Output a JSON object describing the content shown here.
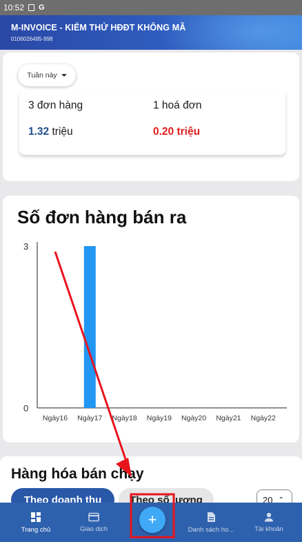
{
  "status_bar": {
    "time": "10:52",
    "icon_g": "G"
  },
  "header": {
    "title": "M-INVOICE - KIỂM THỬ HĐĐT KHÔNG MÃ",
    "tax_code": "0106026495-998"
  },
  "summary": {
    "period_label": "Tuần này",
    "orders_count": "3 đơn hàng",
    "invoices_count": "1 hoá đơn",
    "orders_revenue_value": "1.32",
    "orders_revenue_unit": " triệu",
    "invoices_revenue": "0.20 triệu"
  },
  "chart_data": {
    "type": "bar",
    "title": "Số đơn hàng bán ra",
    "categories": [
      "Ngày16",
      "Ngày17",
      "Ngày18",
      "Ngày19",
      "Ngày20",
      "Ngày21",
      "Ngày22"
    ],
    "values": [
      0,
      3,
      0,
      0,
      0,
      0,
      0
    ],
    "ylim": [
      0,
      3
    ],
    "y_ticks": [
      "0",
      "3"
    ],
    "bar_color": "#2196f3",
    "grid": false
  },
  "best_sellers": {
    "title": "Hàng hóa bán chạy",
    "tab_revenue": "Theo doanh thu",
    "tab_quantity": "Theo số lượng",
    "page_size": "20"
  },
  "bottom_nav": {
    "home": "Trang chủ",
    "transactions": "Giao dịch",
    "invoice_list": "Danh sách ho...",
    "account": "Tài khoản",
    "fab": "+"
  },
  "colors": {
    "header": "#2f5dc0",
    "nav": "#2e61ad",
    "fab": "#3fa9f5",
    "annotation": "#e8141c"
  }
}
